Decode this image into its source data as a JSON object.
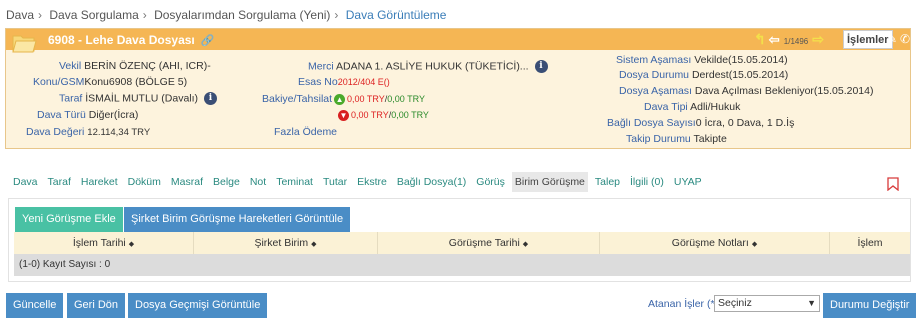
{
  "breadcrumb": [
    "Dava",
    "Dava Sorgulama",
    "Dosyalarımdan Sorgulama (Yeni)",
    "Dava Görüntüleme"
  ],
  "case_header": {
    "title": "6908 - Lehe Dava Dosyası",
    "nav_counter": "1/1496",
    "islemler_label": "İşlemler"
  },
  "case_fields": {
    "vekil_label": "Vekil",
    "vekil_value": "BERİN ÖZENÇ (AHI, ICR)-",
    "konu_label": "Konu/GSM",
    "konu_value": "Konu6908 (BÖLGE 5)",
    "taraf_label": "Taraf",
    "taraf_value": "İSMAİL MUTLU (Davalı)",
    "dava_turu_label": "Dava Türü",
    "dava_turu_value": "Diğer(İcra)",
    "dava_degeri_label": "Dava Değeri",
    "dava_degeri_value": "12.114,34 TRY",
    "merci_label": "Merci",
    "merci_value": "ADANA 1. ASLİYE HUKUK (TÜKETİCİ)...",
    "esas_label": "Esas No",
    "esas_value": "2012/404 E()",
    "bakiye_label": "Bakiye/Tahsilat",
    "bakiye_line1_a": "0,00 TRY",
    "bakiye_line1_b": "0,00 TRY",
    "bakiye_line2_a": "0,00 TRY",
    "bakiye_line2_b": "0,00 TRY",
    "fazla_odeme_label": "Fazla Ödeme",
    "sistem_asamasi_label": "Sistem Aşaması",
    "sistem_asamasi_value": "Vekilde(15.05.2014)",
    "dosya_durumu_label": "Dosya Durumu",
    "dosya_durumu_value": "Derdest(15.05.2014)",
    "dosya_asamasi_label": "Dosya Aşaması",
    "dosya_asamasi_value": "Dava Açılması Bekleniyor(15.05.2014)",
    "dava_tipi_label": "Dava Tipi",
    "dava_tipi_value": "Adli/Hukuk",
    "bagli_dosya_label": "Bağlı Dosya Sayısı",
    "bagli_dosya_value": "0 İcra, 0 Dava, 1 D.İş",
    "takip_durumu_label": "Takip Durumu",
    "takip_durumu_value": "Takipte"
  },
  "tabs": [
    {
      "label": "Dava"
    },
    {
      "label": "Taraf"
    },
    {
      "label": "Hareket"
    },
    {
      "label": "Döküm"
    },
    {
      "label": "Masraf"
    },
    {
      "label": "Belge"
    },
    {
      "label": "Not"
    },
    {
      "label": "Teminat"
    },
    {
      "label": "Tutar"
    },
    {
      "label": "Ekstre"
    },
    {
      "label": "Bağlı Dosya(1)"
    },
    {
      "label": "Görüş"
    },
    {
      "label": "Birim Görüşme"
    },
    {
      "label": "Talep"
    },
    {
      "label": "İlgili (0)"
    },
    {
      "label": "UYAP"
    }
  ],
  "active_tab": "Birim Görüşme",
  "actions": {
    "new_meeting_label": "Yeni Görüşme Ekle",
    "company_unit_moves_label": "Şirket Birim Görüşme Hareketleri Görüntüle"
  },
  "grid": {
    "columns": [
      "İşlem Tarihi",
      "Şirket Birim",
      "Görüşme Tarihi",
      "Görüşme Notları",
      "İşlem"
    ],
    "record_count_text": "(1-0) Kayıt Sayısı : 0"
  },
  "footer": {
    "update_label": "Güncelle",
    "back_label": "Geri Dön",
    "history_label": "Dosya Geçmişi Görüntüle",
    "assigned_label": "Atanan İşler",
    "assigned_marker": "(*)",
    "select_value": "Seçiniz",
    "change_status_label": "Durumu Değiştir"
  },
  "colors": {
    "header_orange": "#f5b654",
    "panel_bg": "#fdf3dd",
    "label_blue": "#3a64a8",
    "tab_teal": "#2a8a80",
    "btn_green": "#49c1a4",
    "btn_blue": "#4a8dc6"
  }
}
